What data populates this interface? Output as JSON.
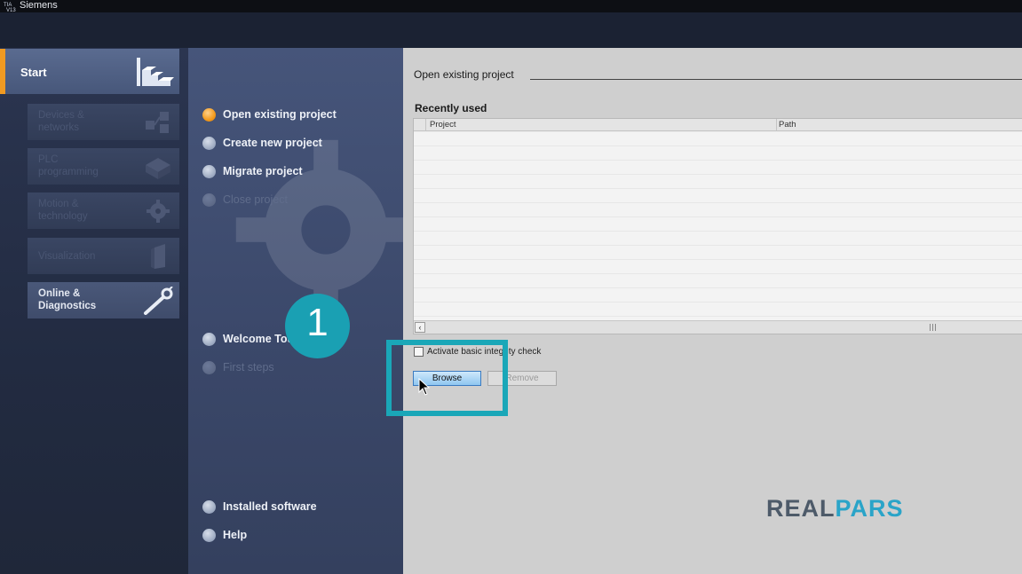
{
  "window": {
    "title": "Siemens"
  },
  "portal": {
    "start_label": "Start",
    "tiles": [
      {
        "label": "Devices &\nnetworks",
        "icon": "devices-networks-icon",
        "enabled": false
      },
      {
        "label": "PLC\nprogramming",
        "icon": "plc-programming-icon",
        "enabled": false
      },
      {
        "label": "Motion &\ntechnology",
        "icon": "motion-gear-icon",
        "enabled": false
      },
      {
        "label": "Visualization",
        "icon": "visualization-panel-icon",
        "enabled": false
      },
      {
        "label": "Online &\nDiagnostics",
        "icon": "online-diagnostics-icon",
        "enabled": true
      }
    ]
  },
  "nav": {
    "open_existing": "Open existing project",
    "create_new": "Create new project",
    "migrate": "Migrate project",
    "close": "Close project",
    "welcome_tour": "Welcome Tour",
    "first_steps": "First steps",
    "installed_software": "Installed software",
    "help": "Help"
  },
  "content": {
    "heading": "Open existing project",
    "recently_used": "Recently used",
    "columns": [
      "Project",
      "Path"
    ],
    "integrity_check_label": "Activate basic integrity check",
    "browse_button": "Browse",
    "remove_button": "Remove"
  },
  "overlay": {
    "step_number": "1",
    "brand_part1": "REAL",
    "brand_part2": "PARS",
    "accent_color": "#1aa7b8",
    "brand_color": "#2aa4c8"
  }
}
